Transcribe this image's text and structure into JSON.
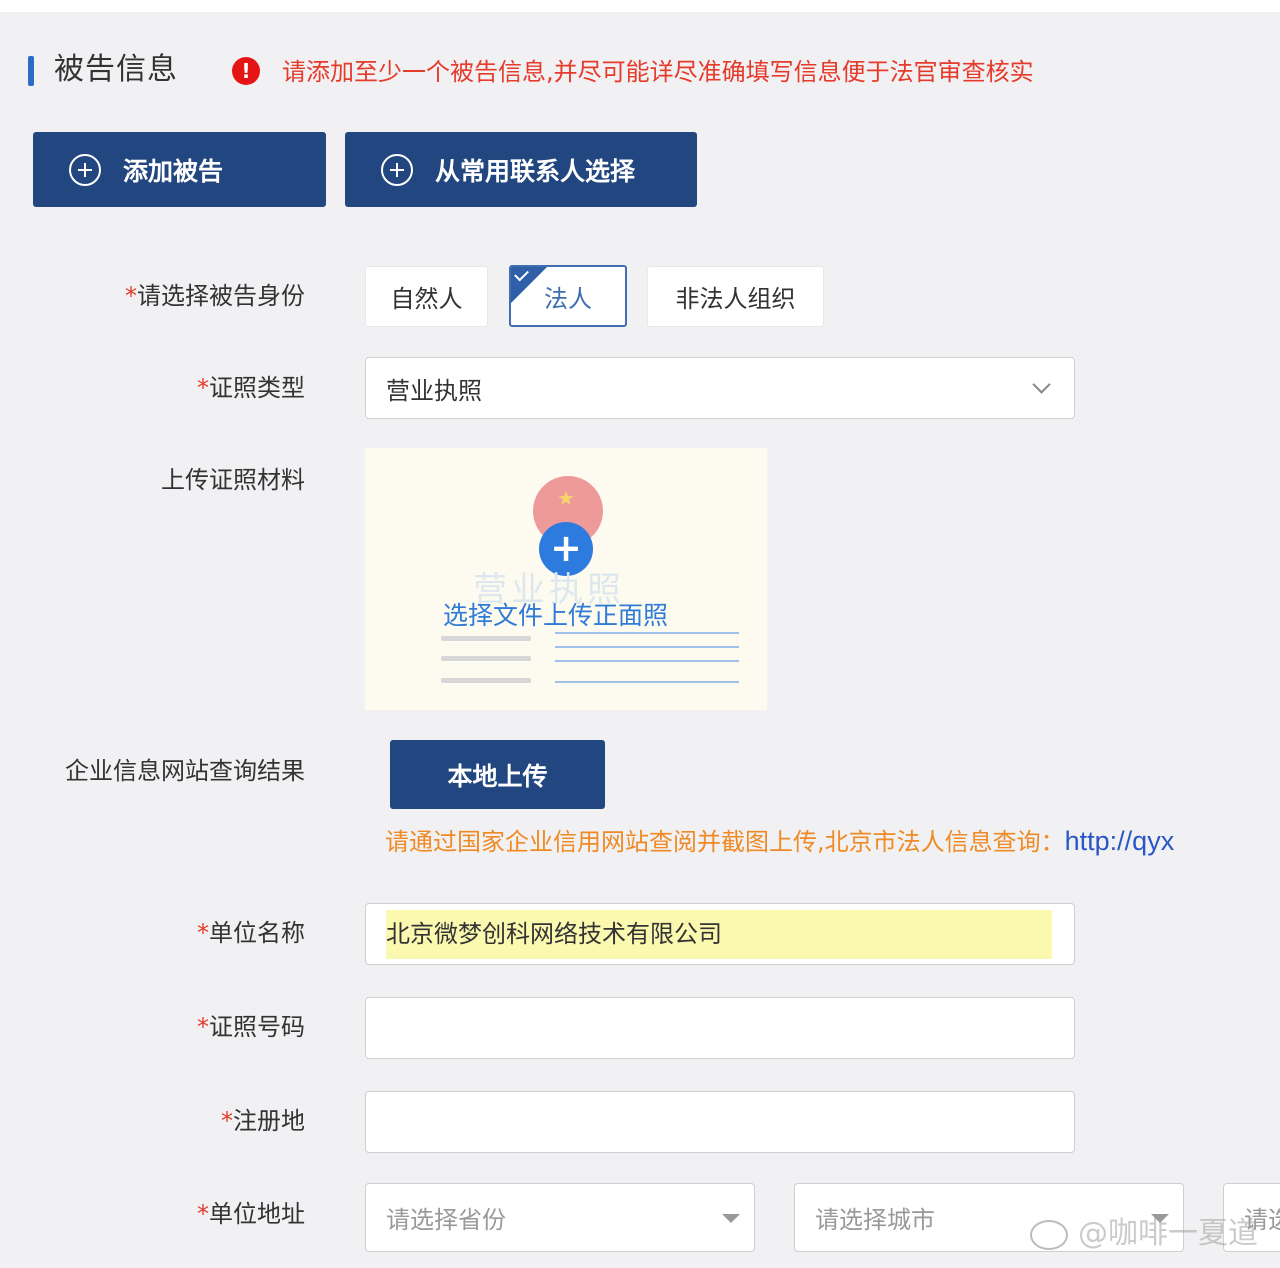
{
  "section": {
    "title": "被告信息",
    "warning_icon": "!",
    "warning": "请添加至少一个被告信息,并尽可能详尽准确填写信息便于法官审查核实"
  },
  "buttons": {
    "add_defendant": "添加被告",
    "from_contacts": "从常用联系人选择",
    "local_upload": "本地上传"
  },
  "identity": {
    "label": "请选择被告身份",
    "options": [
      "自然人",
      "法人",
      "非法人组织"
    ],
    "selected": "法人"
  },
  "license_type": {
    "label": "证照类型",
    "value": "营业执照"
  },
  "upload_material": {
    "label": "上传证照材料",
    "faded_caption": "营业执照",
    "prompt": "选择文件上传正面照"
  },
  "enterprise_query": {
    "label": "企业信息网站查询结果",
    "hint": "请通过国家企业信用网站查阅并截图上传,北京市法人信息查询：",
    "link": "http://qyx"
  },
  "org_name": {
    "label": "单位名称",
    "value": "北京微梦创科网络技术有限公司"
  },
  "license_number": {
    "label": "证照号码",
    "value": ""
  },
  "registered_place": {
    "label": "注册地",
    "value": ""
  },
  "address": {
    "label": "单位地址",
    "province_placeholder": "请选择省份",
    "city_placeholder": "请选择城市",
    "third_placeholder": "请选"
  },
  "watermark": "@咖啡一夏道",
  "required_mark": "*",
  "icons": {
    "warning": "exclamation-circle-icon",
    "add": "plus-circle-icon",
    "dropdown": "chevron-down-icon",
    "upload": "plus-icon",
    "selected": "check-corner-icon"
  },
  "colors": {
    "primary_button": "#22467f",
    "accent_blue": "#3f6fb0",
    "warning_red": "#e63a2b",
    "hint_orange": "#f08a24",
    "highlight_yellow": "#fbf8b0"
  }
}
